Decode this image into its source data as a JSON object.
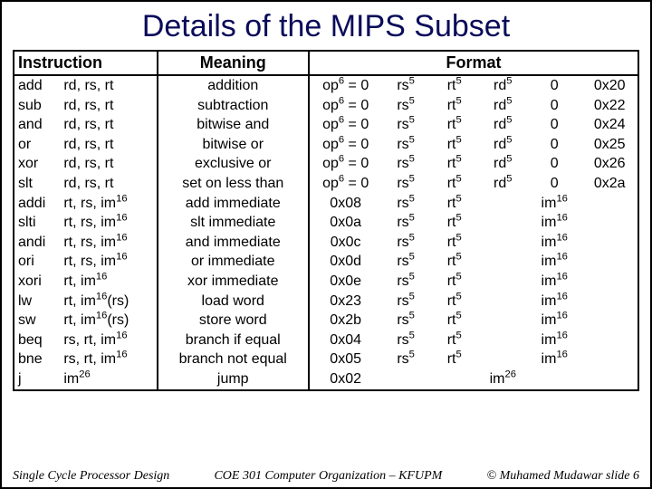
{
  "title": "Details of the MIPS Subset",
  "headers": {
    "instruction": "Instruction",
    "meaning": "Meaning",
    "format": "Format"
  },
  "rows": [
    {
      "mn": "add",
      "ops": "rd, rs, rt",
      "mean": "addition",
      "f": [
        "op<sup>6</sup> = 0",
        "rs<sup>5</sup>",
        "rt<sup>5</sup>",
        "rd<sup>5</sup>",
        "0",
        "0x20"
      ]
    },
    {
      "mn": "sub",
      "ops": "rd, rs, rt",
      "mean": "subtraction",
      "f": [
        "op<sup>6</sup> = 0",
        "rs<sup>5</sup>",
        "rt<sup>5</sup>",
        "rd<sup>5</sup>",
        "0",
        "0x22"
      ]
    },
    {
      "mn": "and",
      "ops": "rd, rs, rt",
      "mean": "bitwise and",
      "f": [
        "op<sup>6</sup> = 0",
        "rs<sup>5</sup>",
        "rt<sup>5</sup>",
        "rd<sup>5</sup>",
        "0",
        "0x24"
      ]
    },
    {
      "mn": "or",
      "ops": "rd, rs, rt",
      "mean": "bitwise or",
      "f": [
        "op<sup>6</sup> = 0",
        "rs<sup>5</sup>",
        "rt<sup>5</sup>",
        "rd<sup>5</sup>",
        "0",
        "0x25"
      ]
    },
    {
      "mn": "xor",
      "ops": "rd, rs, rt",
      "mean": "exclusive or",
      "f": [
        "op<sup>6</sup> = 0",
        "rs<sup>5</sup>",
        "rt<sup>5</sup>",
        "rd<sup>5</sup>",
        "0",
        "0x26"
      ]
    },
    {
      "mn": "slt",
      "ops": "rd, rs, rt",
      "mean": "set on less than",
      "f": [
        "op<sup>6</sup> = 0",
        "rs<sup>5</sup>",
        "rt<sup>5</sup>",
        "rd<sup>5</sup>",
        "0",
        "0x2a"
      ]
    },
    {
      "mn": "addi",
      "ops": "rt, rs, im<sup>16</sup>",
      "mean": "add immediate",
      "f": [
        "0x08",
        "rs<sup>5</sup>",
        "rt<sup>5</sup>",
        "",
        "im<sup>16</sup>",
        ""
      ]
    },
    {
      "mn": "slti",
      "ops": "rt, rs, im<sup>16</sup>",
      "mean": "slt immediate",
      "f": [
        "0x0a",
        "rs<sup>5</sup>",
        "rt<sup>5</sup>",
        "",
        "im<sup>16</sup>",
        ""
      ]
    },
    {
      "mn": "andi",
      "ops": "rt, rs, im<sup>16</sup>",
      "mean": "and immediate",
      "f": [
        "0x0c",
        "rs<sup>5</sup>",
        "rt<sup>5</sup>",
        "",
        "im<sup>16</sup>",
        ""
      ]
    },
    {
      "mn": "ori",
      "ops": "rt, rs, im<sup>16</sup>",
      "mean": "or immediate",
      "f": [
        "0x0d",
        "rs<sup>5</sup>",
        "rt<sup>5</sup>",
        "",
        "im<sup>16</sup>",
        ""
      ]
    },
    {
      "mn": "xori",
      "ops": "rt, im<sup>16</sup>",
      "mean": "xor immediate",
      "f": [
        "0x0e",
        "rs<sup>5</sup>",
        "rt<sup>5</sup>",
        "",
        "im<sup>16</sup>",
        ""
      ]
    },
    {
      "mn": "lw",
      "ops": "rt, im<sup>16</sup>(rs)",
      "mean": "load word",
      "f": [
        "0x23",
        "rs<sup>5</sup>",
        "rt<sup>5</sup>",
        "",
        "im<sup>16</sup>",
        ""
      ]
    },
    {
      "mn": "sw",
      "ops": "rt, im<sup>16</sup>(rs)",
      "mean": "store word",
      "f": [
        "0x2b",
        "rs<sup>5</sup>",
        "rt<sup>5</sup>",
        "",
        "im<sup>16</sup>",
        ""
      ]
    },
    {
      "mn": "beq",
      "ops": "rs, rt, im<sup>16</sup>",
      "mean": "branch if equal",
      "f": [
        "0x04",
        "rs<sup>5</sup>",
        "rt<sup>5</sup>",
        "",
        "im<sup>16</sup>",
        ""
      ]
    },
    {
      "mn": "bne",
      "ops": "rs, rt, im<sup>16</sup>",
      "mean": "branch not equal",
      "f": [
        "0x05",
        "rs<sup>5</sup>",
        "rt<sup>5</sup>",
        "",
        "im<sup>16</sup>",
        ""
      ]
    },
    {
      "mn": "j",
      "ops": "im<sup>26</sup>",
      "mean": "jump",
      "f": [
        "0x02",
        "",
        "",
        "im<sup>26</sup>",
        "",
        ""
      ]
    }
  ],
  "footer": {
    "left": "Single Cycle Processor Design",
    "center": "COE 301 Computer Organization – KFUPM",
    "right": "© Muhamed Mudawar  slide 6"
  }
}
